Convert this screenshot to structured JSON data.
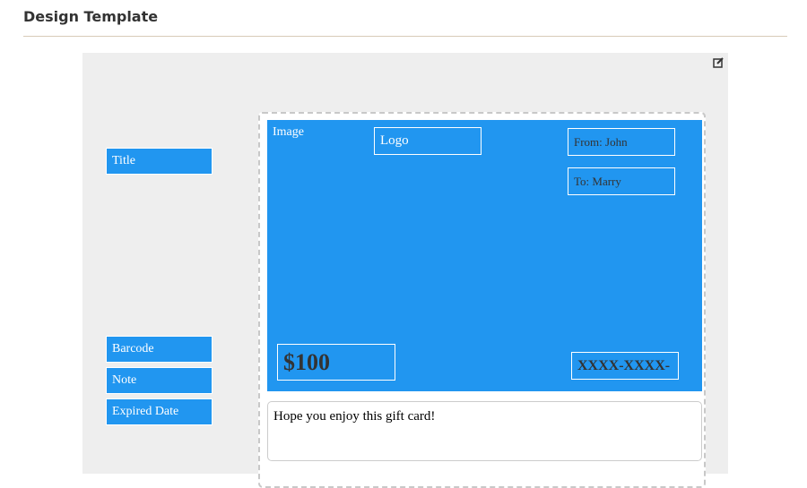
{
  "header": {
    "title": "Design Template"
  },
  "icons": {
    "edit": "edit-icon"
  },
  "fields": [
    "Title",
    "Barcode",
    "Note",
    "Expired Date"
  ],
  "card": {
    "image": "Image",
    "logo": "Logo",
    "from": "From: John",
    "to": "To: Marry",
    "value": "$100",
    "code": "XXXX-XXXX-",
    "note": "Hope you enjoy this gift card!"
  },
  "colors": {
    "accent": "#2196f0",
    "panel": "#eeeeee"
  }
}
